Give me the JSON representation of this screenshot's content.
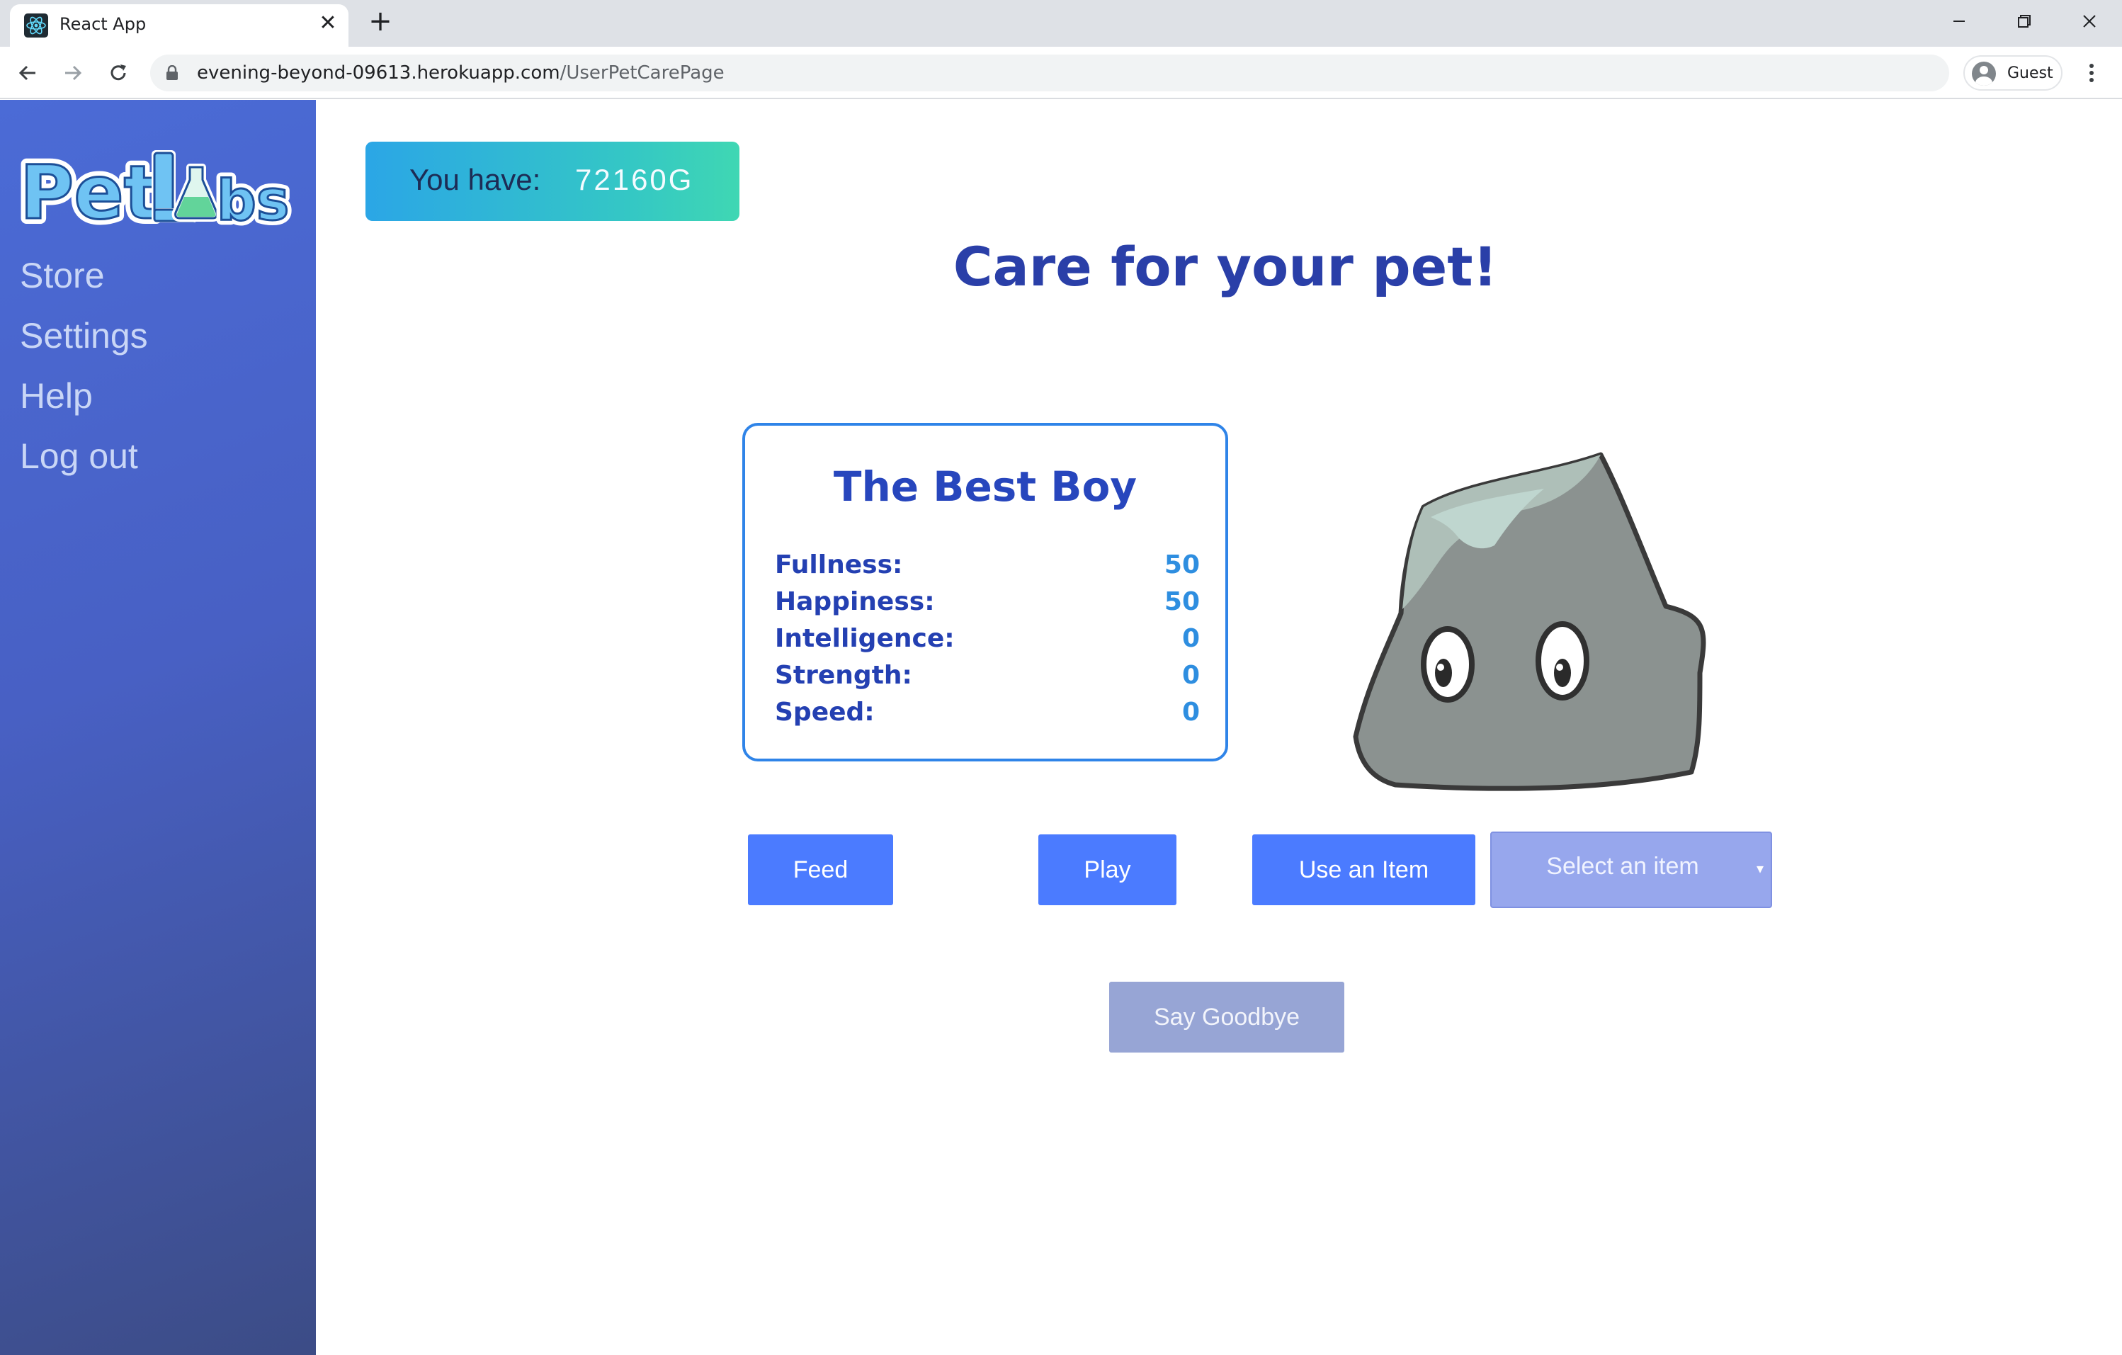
{
  "browser": {
    "tab_title": "React App",
    "tab_close": "✕",
    "new_tab": "+",
    "url_host": "evening-beyond-09613.herokuapp.com",
    "url_path": "/UserPetCarePage",
    "profile_name": "Guest"
  },
  "sidebar": {
    "logo_text": "PetLabs",
    "items": [
      {
        "label": "Store"
      },
      {
        "label": "Settings"
      },
      {
        "label": "Help"
      },
      {
        "label": "Log out"
      }
    ]
  },
  "balance": {
    "label": "You have:",
    "value": "72160G"
  },
  "page_title": "Care for your pet!",
  "pet": {
    "name": "The Best Boy",
    "stats": [
      {
        "label": "Fullness:",
        "value": "50"
      },
      {
        "label": "Happiness:",
        "value": "50"
      },
      {
        "label": "Intelligence:",
        "value": "0"
      },
      {
        "label": "Strength:",
        "value": "0"
      },
      {
        "label": "Speed:",
        "value": "0"
      }
    ]
  },
  "actions": {
    "feed": "Feed",
    "play": "Play",
    "use_item": "Use an Item",
    "select_item": "Select an item",
    "say_goodbye": "Say Goodbye"
  },
  "colors": {
    "sidebar": "#4b6bd6",
    "primary_button": "#4b7bff",
    "title": "#2a3fa8",
    "card_border": "#2f84e8"
  }
}
